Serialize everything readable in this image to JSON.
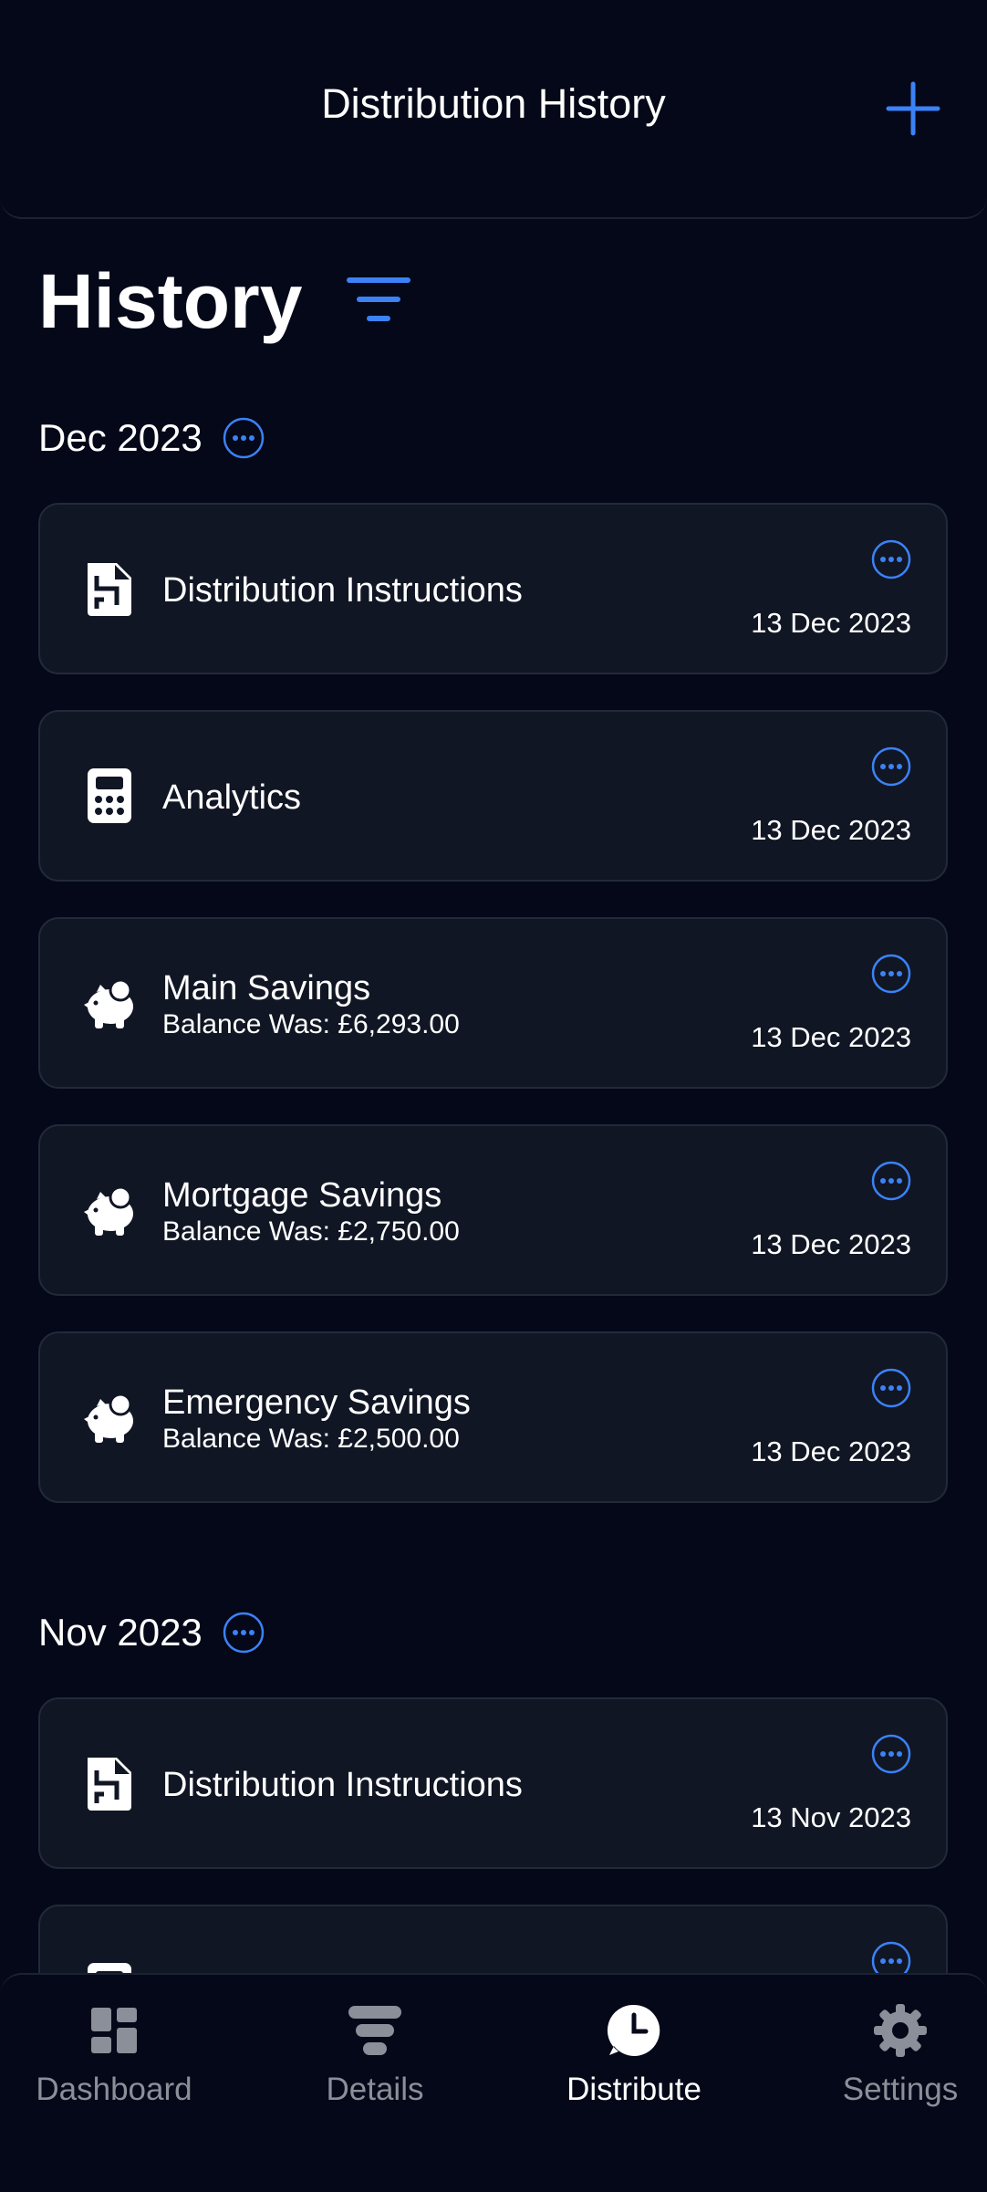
{
  "header": {
    "title": "Distribution History",
    "add_icon": "plus-icon"
  },
  "page": {
    "title": "History",
    "filter_icon": "filter-icon"
  },
  "accent": "#3b82f6",
  "groups": [
    {
      "month": "Dec 2023",
      "items": [
        {
          "icon": "document-icon",
          "title": "Distribution Instructions",
          "subtitle": "",
          "date": "13 Dec 2023"
        },
        {
          "icon": "calculator-icon",
          "title": "Analytics",
          "subtitle": "",
          "date": "13 Dec 2023"
        },
        {
          "icon": "piggy-bank-icon",
          "title": "Main Savings",
          "subtitle": "Balance Was: £6,293.00",
          "date": "13 Dec 2023"
        },
        {
          "icon": "piggy-bank-icon",
          "title": "Mortgage Savings",
          "subtitle": "Balance Was: £2,750.00",
          "date": "13 Dec 2023"
        },
        {
          "icon": "piggy-bank-icon",
          "title": "Emergency Savings",
          "subtitle": "Balance Was: £2,500.00",
          "date": "13 Dec 2023"
        }
      ]
    },
    {
      "month": "Nov 2023",
      "items": [
        {
          "icon": "document-icon",
          "title": "Distribution Instructions",
          "subtitle": "",
          "date": "13 Nov 2023"
        }
      ]
    }
  ],
  "nav": [
    {
      "label": "Dashboard",
      "icon": "dashboard-icon",
      "active": false
    },
    {
      "label": "Details",
      "icon": "details-icon",
      "active": false
    },
    {
      "label": "Distribute",
      "icon": "clock-icon",
      "active": true
    },
    {
      "label": "Settings",
      "icon": "gear-icon",
      "active": false
    }
  ]
}
